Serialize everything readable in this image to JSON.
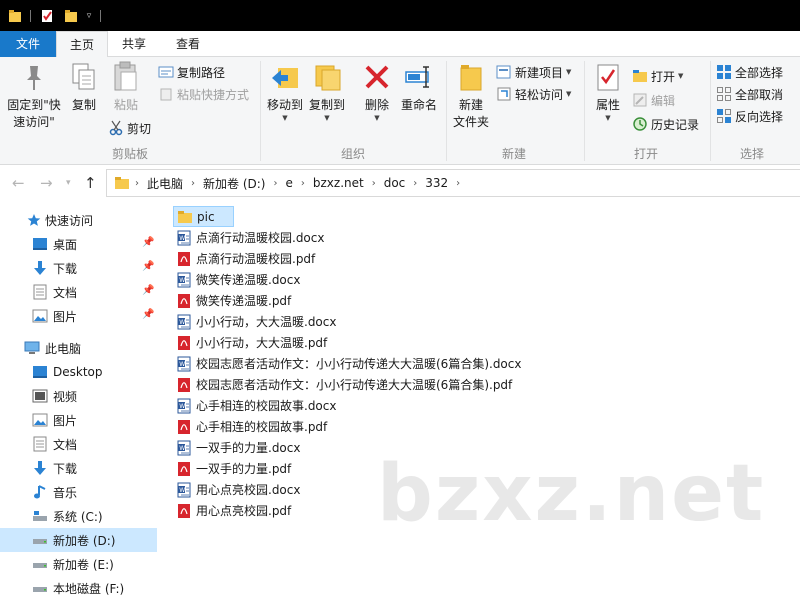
{
  "ribbon_tabs": {
    "file": "文件",
    "home": "主页",
    "share": "共享",
    "view": "查看"
  },
  "clipboard": {
    "pin_line1": "固定到\"快",
    "pin_line2": "速访问\"",
    "copy": "复制",
    "paste": "粘贴",
    "copy_path": "复制路径",
    "paste_shortcut": "粘贴快捷方式",
    "cut": "剪切",
    "label": "剪贴板"
  },
  "organize": {
    "move_to": "移动到",
    "copy_to": "复制到",
    "delete": "删除",
    "rename": "重命名",
    "label": "组织"
  },
  "new_group": {
    "new_folder_line1": "新建",
    "new_folder_line2": "文件夹",
    "new_item": "新建项目",
    "easy_access": "轻松访问",
    "label": "新建"
  },
  "open_group": {
    "properties": "属性",
    "open": "打开",
    "edit": "编辑",
    "history": "历史记录",
    "label": "打开"
  },
  "select_group": {
    "select_all": "全部选择",
    "select_none": "全部取消",
    "invert": "反向选择",
    "label": "选择"
  },
  "breadcrumb": [
    "此电脑",
    "新加卷 (D:)",
    "e",
    "bzxz.net",
    "doc",
    "332"
  ],
  "nav": {
    "quick_access": "快速访问",
    "quick_items": [
      "桌面",
      "下载",
      "文档",
      "图片"
    ],
    "this_pc": "此电脑",
    "pc_items": [
      "Desktop",
      "视频",
      "图片",
      "文档",
      "下载",
      "音乐",
      "系统 (C:)",
      "新加卷 (D:)",
      "新加卷 (E:)",
      "本地磁盘 (F:)"
    ]
  },
  "files": [
    {
      "name": "pic",
      "type": "folder"
    },
    {
      "name": "点滴行动温暖校园.docx",
      "type": "docx"
    },
    {
      "name": "点滴行动温暖校园.pdf",
      "type": "pdf"
    },
    {
      "name": "微笑传递温暖.docx",
      "type": "docx"
    },
    {
      "name": "微笑传递温暖.pdf",
      "type": "pdf"
    },
    {
      "name": "小小行动，大大温暖.docx",
      "type": "docx"
    },
    {
      "name": "小小行动，大大温暖.pdf",
      "type": "pdf"
    },
    {
      "name": "校园志愿者活动作文：小小行动传递大大温暖(6篇合集).docx",
      "type": "docx"
    },
    {
      "name": "校园志愿者活动作文：小小行动传递大大温暖(6篇合集).pdf",
      "type": "pdf"
    },
    {
      "name": "心手相连的校园故事.docx",
      "type": "docx"
    },
    {
      "name": "心手相连的校园故事.pdf",
      "type": "pdf"
    },
    {
      "name": "一双手的力量.docx",
      "type": "docx"
    },
    {
      "name": "一双手的力量.pdf",
      "type": "pdf"
    },
    {
      "name": "用心点亮校园.docx",
      "type": "docx"
    },
    {
      "name": "用心点亮校园.pdf",
      "type": "pdf"
    }
  ],
  "watermark": "bzxz.net",
  "colors": {
    "accent": "#1979ca",
    "selection": "#cce8ff",
    "folder": "#f6c94d",
    "pdf": "#d7252d",
    "docx": "#2b579a"
  }
}
